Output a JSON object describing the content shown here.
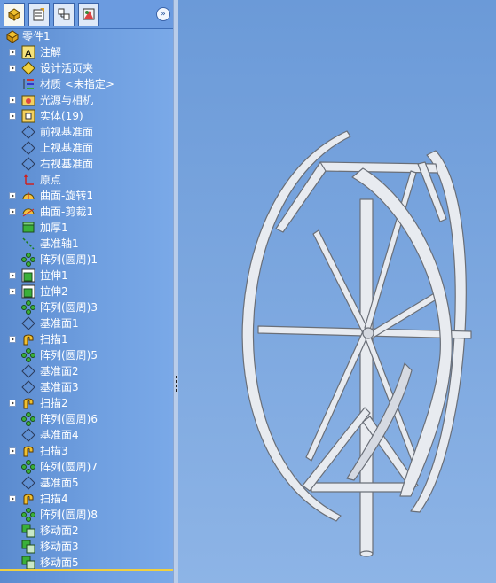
{
  "tabs": [
    {
      "name": "feature-manager-tab-icon",
      "active": true
    },
    {
      "name": "property-manager-tab-icon",
      "active": false
    },
    {
      "name": "configuration-manager-tab-icon",
      "active": false
    },
    {
      "name": "display-manager-tab-icon",
      "active": false
    }
  ],
  "expand_button_glyph": "»",
  "tree": {
    "root": {
      "label": "零件1",
      "icon": "part-icon"
    },
    "items": [
      {
        "label": "注解",
        "icon": "annotations-icon",
        "expandable": true
      },
      {
        "label": "设计活页夹",
        "icon": "design-binder-icon",
        "expandable": true
      },
      {
        "label": "材质 <未指定>",
        "icon": "material-icon",
        "expandable": false
      },
      {
        "label": "光源与相机",
        "icon": "lights-cameras-icon",
        "expandable": true
      },
      {
        "label": "实体(19)",
        "icon": "solid-bodies-icon",
        "expandable": true
      },
      {
        "label": "前视基准面",
        "icon": "plane-icon",
        "expandable": false
      },
      {
        "label": "上视基准面",
        "icon": "plane-icon",
        "expandable": false
      },
      {
        "label": "右视基准面",
        "icon": "plane-icon",
        "expandable": false
      },
      {
        "label": "原点",
        "icon": "origin-icon",
        "expandable": false
      },
      {
        "label": "曲面-旋转1",
        "icon": "surface-revolve-icon",
        "expandable": true
      },
      {
        "label": "曲面-剪裁1",
        "icon": "surface-trim-icon",
        "expandable": true
      },
      {
        "label": "加厚1",
        "icon": "thicken-icon",
        "expandable": false
      },
      {
        "label": "基准轴1",
        "icon": "axis-icon",
        "expandable": false
      },
      {
        "label": "阵列(圆周)1",
        "icon": "circular-pattern-icon",
        "expandable": false
      },
      {
        "label": "拉伸1",
        "icon": "extrude-icon",
        "expandable": true
      },
      {
        "label": "拉伸2",
        "icon": "extrude-icon",
        "expandable": true
      },
      {
        "label": "阵列(圆周)3",
        "icon": "circular-pattern-icon",
        "expandable": false
      },
      {
        "label": "基准面1",
        "icon": "plane-icon",
        "expandable": false
      },
      {
        "label": "扫描1",
        "icon": "sweep-icon",
        "expandable": true
      },
      {
        "label": "阵列(圆周)5",
        "icon": "circular-pattern-icon",
        "expandable": false
      },
      {
        "label": "基准面2",
        "icon": "plane-icon",
        "expandable": false
      },
      {
        "label": "基准面3",
        "icon": "plane-icon",
        "expandable": false
      },
      {
        "label": "扫描2",
        "icon": "sweep-icon",
        "expandable": true
      },
      {
        "label": "阵列(圆周)6",
        "icon": "circular-pattern-icon",
        "expandable": false
      },
      {
        "label": "基准面4",
        "icon": "plane-icon",
        "expandable": false
      },
      {
        "label": "扫描3",
        "icon": "sweep-icon",
        "expandable": true
      },
      {
        "label": "阵列(圆周)7",
        "icon": "circular-pattern-icon",
        "expandable": false
      },
      {
        "label": "基准面5",
        "icon": "plane-icon",
        "expandable": false
      },
      {
        "label": "扫描4",
        "icon": "sweep-icon",
        "expandable": true
      },
      {
        "label": "阵列(圆周)8",
        "icon": "circular-pattern-icon",
        "expandable": false
      },
      {
        "label": "移动面2",
        "icon": "move-face-icon",
        "expandable": false
      },
      {
        "label": "移动面3",
        "icon": "move-face-icon",
        "expandable": false
      },
      {
        "label": "移动面5",
        "icon": "move-face-icon",
        "expandable": false
      }
    ]
  },
  "colors": {
    "panel_bg": "#6f9fe0",
    "viewport_bg": "#7ba7e0",
    "model_fill": "#e8ebf0",
    "model_stroke": "#6a6f78"
  }
}
